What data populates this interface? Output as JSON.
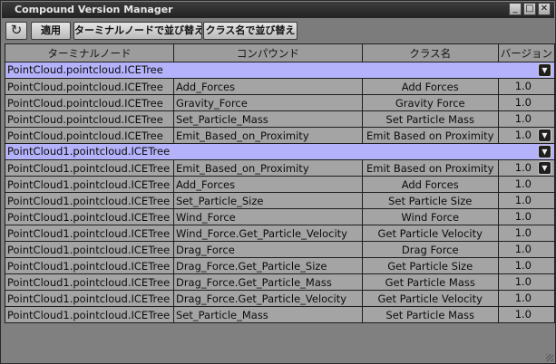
{
  "window": {
    "title": "Compound Version Manager",
    "controls": {
      "minimize": "_",
      "maximize": "□",
      "close": "✕"
    }
  },
  "toolbar": {
    "refresh_icon": "↻",
    "apply_label": "適用",
    "sort_terminal_label": "ターミナルノードで並び替え",
    "sort_class_label": "クラス名で並び替え"
  },
  "table": {
    "headers": [
      "ターミナルノード",
      "コンパウンド",
      "クラス名",
      "バージョン"
    ],
    "dropdown_icon": "▼",
    "rows": [
      {
        "type": "group",
        "terminal": "PointCloud.pointcloud.ICETree",
        "dropdown": true
      },
      {
        "type": "item",
        "terminal": "PointCloud.pointcloud.ICETree",
        "compound": "Add_Forces",
        "class": "Add Forces",
        "version": "1.0",
        "dropdown": false
      },
      {
        "type": "item",
        "terminal": "PointCloud.pointcloud.ICETree",
        "compound": "Gravity_Force",
        "class": "Gravity Force",
        "version": "1.0",
        "dropdown": false
      },
      {
        "type": "item",
        "terminal": "PointCloud.pointcloud.ICETree",
        "compound": "Set_Particle_Mass",
        "class": "Set Particle Mass",
        "version": "1.0",
        "dropdown": false
      },
      {
        "type": "item",
        "terminal": "PointCloud.pointcloud.ICETree",
        "compound": "Emit_Based_on_Proximity",
        "class": "Emit Based on Proximity",
        "version": "1.0",
        "dropdown": true
      },
      {
        "type": "group",
        "terminal": "PointCloud1.pointcloud.ICETree",
        "dropdown": true
      },
      {
        "type": "item",
        "terminal": "PointCloud1.pointcloud.ICETree",
        "compound": "Emit_Based_on_Proximity",
        "class": "Emit Based on Proximity",
        "version": "1.0",
        "dropdown": true
      },
      {
        "type": "item",
        "terminal": "PointCloud1.pointcloud.ICETree",
        "compound": "Add_Forces",
        "class": "Add Forces",
        "version": "1.0",
        "dropdown": false
      },
      {
        "type": "item",
        "terminal": "PointCloud1.pointcloud.ICETree",
        "compound": "Set_Particle_Size",
        "class": "Set Particle Size",
        "version": "1.0",
        "dropdown": false
      },
      {
        "type": "item",
        "terminal": "PointCloud1.pointcloud.ICETree",
        "compound": "Wind_Force",
        "class": "Wind Force",
        "version": "1.0",
        "dropdown": false
      },
      {
        "type": "item",
        "terminal": "PointCloud1.pointcloud.ICETree",
        "compound": "Wind_Force.Get_Particle_Velocity",
        "class": "Get Particle Velocity",
        "version": "1.0",
        "dropdown": false
      },
      {
        "type": "item",
        "terminal": "PointCloud1.pointcloud.ICETree",
        "compound": "Drag_Force",
        "class": "Drag Force",
        "version": "1.0",
        "dropdown": false
      },
      {
        "type": "item",
        "terminal": "PointCloud1.pointcloud.ICETree",
        "compound": "Drag_Force.Get_Particle_Size",
        "class": "Get Particle Size",
        "version": "1.0",
        "dropdown": false
      },
      {
        "type": "item",
        "terminal": "PointCloud1.pointcloud.ICETree",
        "compound": "Drag_Force.Get_Particle_Mass",
        "class": "Get Particle Mass",
        "version": "1.0",
        "dropdown": false
      },
      {
        "type": "item",
        "terminal": "PointCloud1.pointcloud.ICETree",
        "compound": "Drag_Force.Get_Particle_Velocity",
        "class": "Get Particle Velocity",
        "version": "1.0",
        "dropdown": false
      },
      {
        "type": "item",
        "terminal": "PointCloud1.pointcloud.ICETree",
        "compound": "Set_Particle_Mass",
        "class": "Set Particle Mass",
        "version": "1.0",
        "dropdown": false
      }
    ]
  },
  "colors": {
    "group_row": "#b4b2fa",
    "cell": "#a4a4a4",
    "header": "#9c9c9c",
    "titlebar": "#2e2e2e"
  }
}
